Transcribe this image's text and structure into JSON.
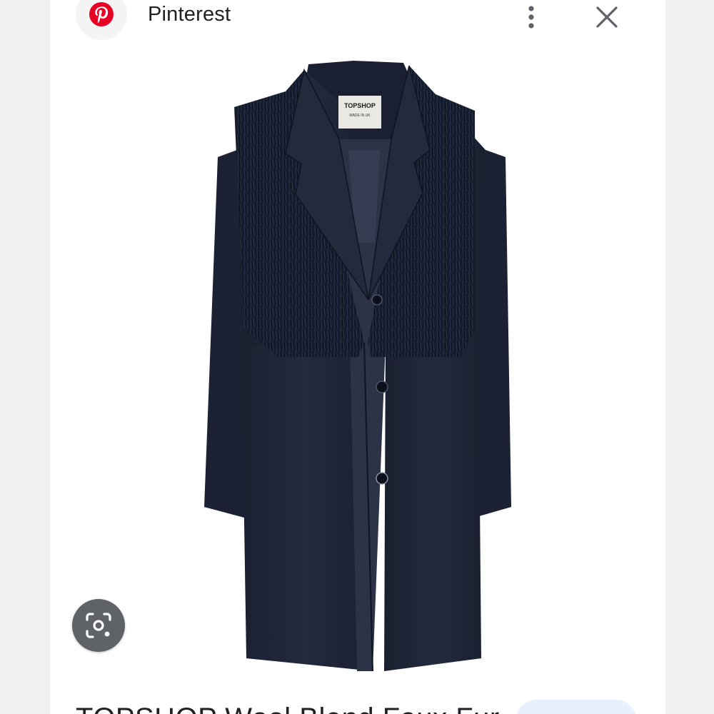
{
  "header": {
    "source_name": "Pinterest",
    "source_icon": "pinterest-logo-icon",
    "more_icon": "more-vertical-icon",
    "close_icon": "close-icon"
  },
  "image": {
    "brand_label_line1": "TOPSHOP",
    "brand_label_line2": "MADE IN UK"
  },
  "lens_button": {
    "icon": "lens-search-icon"
  },
  "result": {
    "title": "TOPSHOP Wool Blend Faux Fur"
  },
  "colors": {
    "pinterest_red": "#E60023",
    "coat_navy": "#1e2536",
    "fur_navy": "#131a29",
    "lens_button_bg": "#5f6368",
    "visit_pill_bg": "#e8f0fe"
  }
}
